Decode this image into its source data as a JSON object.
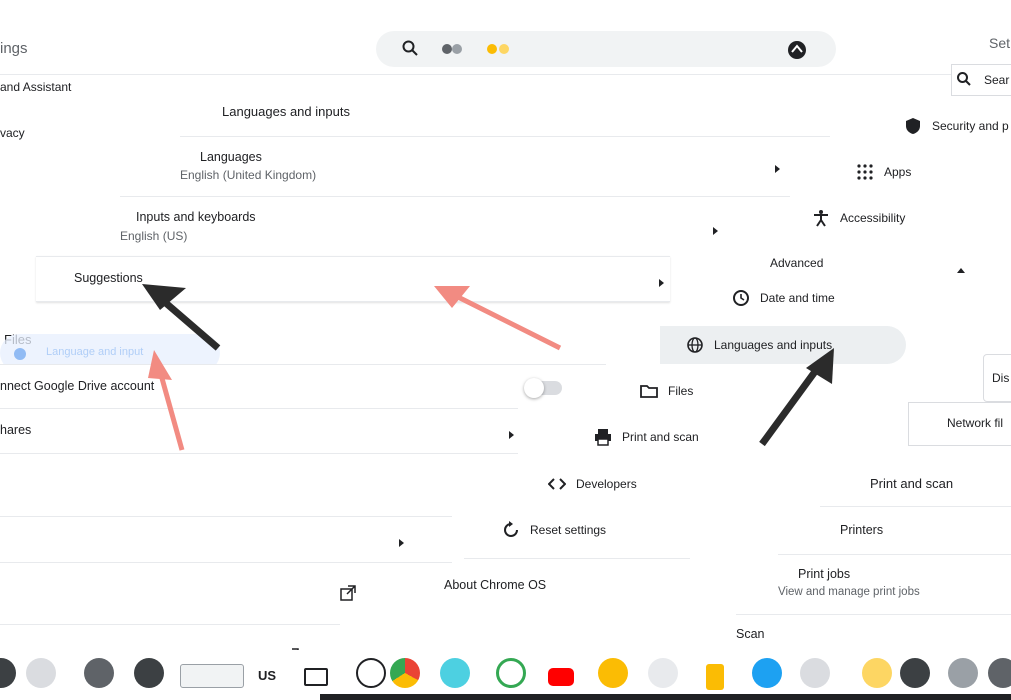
{
  "header": {
    "title_fragment": "ings",
    "right_fragment": "Set",
    "search_button_fragment": "Sear"
  },
  "left_menu": {
    "top_item": "and Assistant",
    "privacy_item": "vacy"
  },
  "languages_panel": {
    "heading": "Languages and inputs",
    "rows": [
      {
        "title": "Languages",
        "subtitle": "English (United Kingdom)"
      },
      {
        "title": "Inputs and keyboards",
        "subtitle": "English (US)"
      },
      {
        "title": "Suggestions",
        "subtitle": ""
      }
    ]
  },
  "files_panel": {
    "heading": "Files",
    "tooltip_fragment": "Language and input",
    "rows": [
      {
        "title": "nnect Google Drive account"
      },
      {
        "title": "hares"
      }
    ]
  },
  "lower_panel": {
    "rows": [
      {
        "title": ""
      },
      {
        "title": ""
      },
      {
        "title": ""
      }
    ]
  },
  "right_menu": {
    "items": [
      {
        "label": "Security and p",
        "icon": "shield-icon"
      },
      {
        "label": "Apps",
        "icon": "apps-grid-icon"
      },
      {
        "label": "Accessibility",
        "icon": "accessibility-icon"
      },
      {
        "label": "Advanced",
        "icon": "chevron-up-icon"
      },
      {
        "label": "Date and time",
        "icon": "clock-icon"
      },
      {
        "label": "Languages and inputs",
        "icon": "globe-icon"
      },
      {
        "label": "Files",
        "icon": "folder-icon"
      },
      {
        "label": "Print and scan",
        "icon": "printer-icon"
      },
      {
        "label": "Developers",
        "icon": "code-icon"
      },
      {
        "label": "Reset settings",
        "icon": "reset-icon"
      },
      {
        "label": "About Chrome OS",
        "icon": ""
      }
    ]
  },
  "right_side_fragments": {
    "disconnect": "Dis",
    "network_file": "Network fil"
  },
  "print_panel": {
    "heading": "Print and scan",
    "rows": [
      {
        "title": "Printers",
        "subtitle": ""
      },
      {
        "title": "Print jobs",
        "subtitle": "View and manage print jobs"
      },
      {
        "title": "Scan",
        "subtitle": ""
      }
    ]
  },
  "shelf": {
    "text_fragment": "US"
  },
  "colors": {
    "accent": "#1a73e8",
    "arrow_dark": "#2b2b2b",
    "arrow_red": "#f28b82"
  }
}
